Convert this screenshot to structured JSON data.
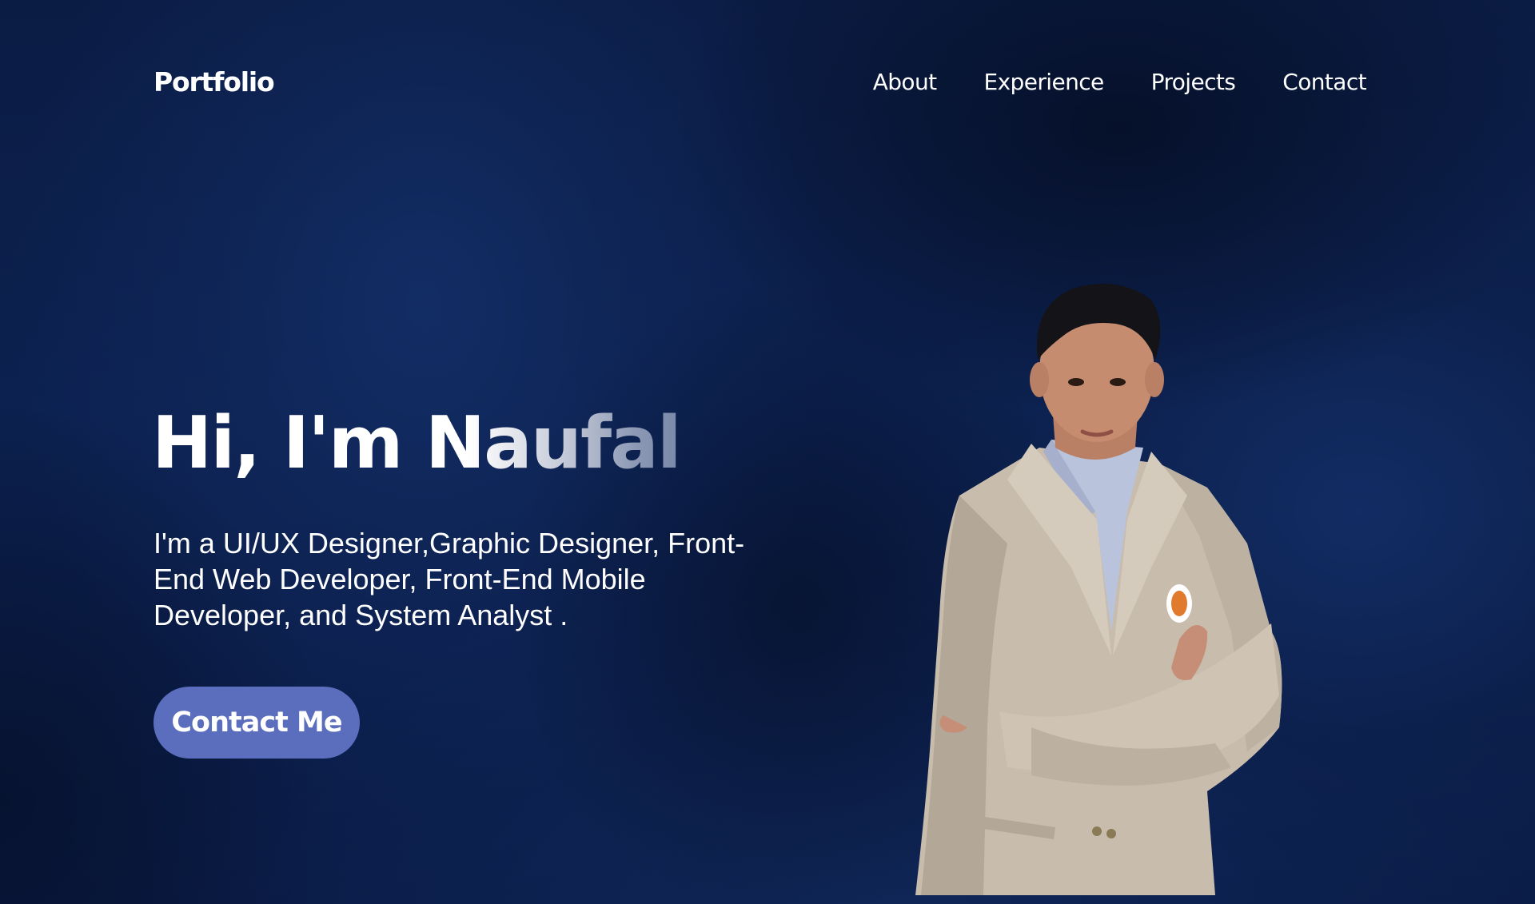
{
  "header": {
    "brand": "Portfolio",
    "nav": {
      "about": "About",
      "experience": "Experience",
      "projects": "Projects",
      "contact": "Contact"
    }
  },
  "hero": {
    "title": "Hi, I'm Naufal",
    "subtitle": "I'm a UI/UX Designer,Graphic Designer, Front-End Web Developer, Front-End Mobile Developer, and System Analyst .",
    "cta_label": "Contact Me"
  },
  "colors": {
    "background": "#0c2150",
    "button": "#5b6dbd",
    "text": "#ffffff"
  }
}
